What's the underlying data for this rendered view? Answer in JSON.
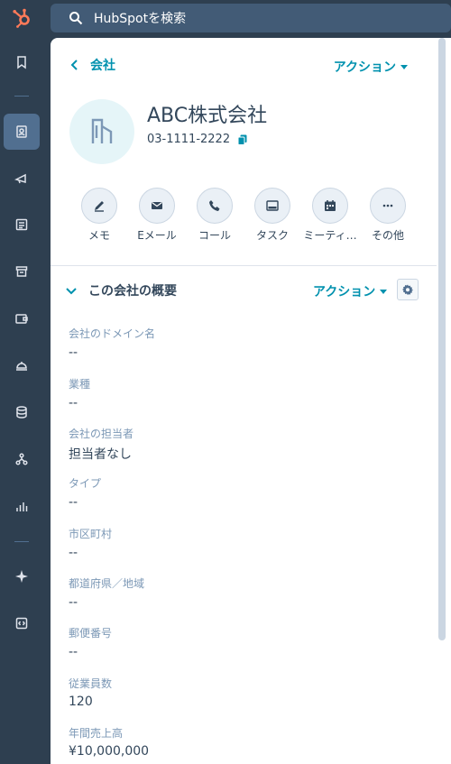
{
  "search": {
    "placeholder": "HubSpotを検索"
  },
  "header": {
    "back_label": "会社",
    "action_label": "アクション"
  },
  "company": {
    "name": "ABC株式会社",
    "phone": "03-1111-2222"
  },
  "quick_actions": [
    {
      "label": "メモ",
      "icon": "pencil-icon"
    },
    {
      "label": "Eメール",
      "icon": "envelope-icon"
    },
    {
      "label": "コール",
      "icon": "phone-icon"
    },
    {
      "label": "タスク",
      "icon": "task-icon"
    },
    {
      "label": "ミーティ…",
      "icon": "calendar-icon"
    },
    {
      "label": "その他",
      "icon": "more-icon"
    }
  ],
  "about": {
    "title": "この会社の概要",
    "action_label": "アクション",
    "properties": [
      {
        "label": "会社のドメイン名",
        "value": "--"
      },
      {
        "label": "業種",
        "value": "--"
      },
      {
        "label": "会社の担当者",
        "value": "担当者なし"
      },
      {
        "label": "タイプ",
        "value": "--"
      },
      {
        "label": "市区町村",
        "value": "--"
      },
      {
        "label": "都道府県／地域",
        "value": "--"
      },
      {
        "label": "郵便番号",
        "value": "--"
      },
      {
        "label": "従業員数",
        "value": "120"
      },
      {
        "label": "年間売上高",
        "value": "¥10,000,000"
      }
    ]
  },
  "colors": {
    "accent": "#0091ae",
    "rail": "#2e3f50",
    "rail_active": "#516f90",
    "brand_orange": "#ff7a59",
    "text": "#33475b",
    "muted": "#7c98b6"
  }
}
